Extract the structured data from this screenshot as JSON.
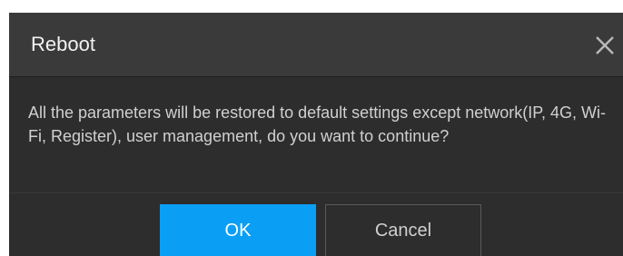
{
  "dialog": {
    "title": "Reboot",
    "close_icon": "close-icon",
    "message": "All the parameters will be restored to default settings except network(IP, 4G, Wi-Fi, Register), user management, do you want to continue?",
    "ok_label": "OK",
    "cancel_label": "Cancel"
  },
  "colors": {
    "header_bg": "#3a3a3a",
    "body_bg": "#2d2d2d",
    "primary_button": "#0a9ff5",
    "title_text": "#f2f2f2",
    "message_text": "#d0d0d0"
  }
}
